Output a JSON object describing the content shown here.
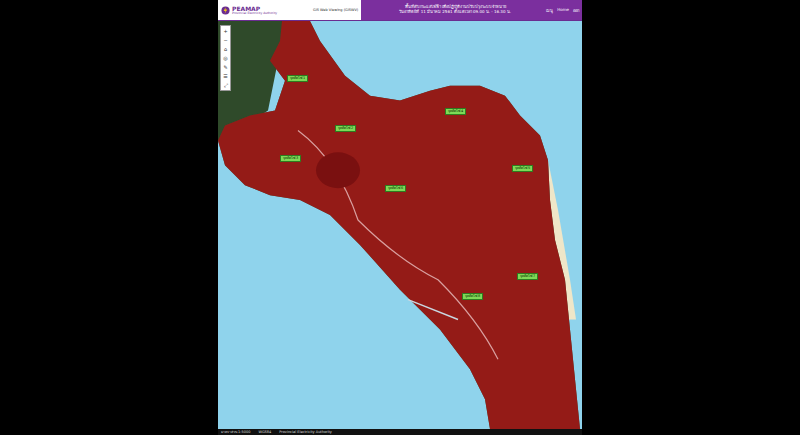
{
  "window": {
    "title": "PEAMAP"
  },
  "header": {
    "logo": "PEAMAP",
    "subtitle": "Provincial Electricity Authority",
    "app": "GIS Web Viewing (GISWV)",
    "title_lines": [
      "พื้นที่ดับกระแสไฟฟ้า เพื่อปฏิบัติงานปรับปรุงระบบจำหน่าย",
      "วันอาทิตย์ที่ 11 มีนาคม 2561 ตั้งแต่เวลา 09.00 น. - 16.30 น."
    ],
    "menu": [
      "เมนู",
      "Home",
      "ออก"
    ]
  },
  "toolbar": [
    "+",
    "−",
    "⌂",
    "◎",
    "✎",
    "☰",
    "⤢"
  ],
  "map": {
    "labels": [
      {
        "text": "จุดตัดไฟ 1"
      },
      {
        "text": "จุดตัดไฟ 2"
      },
      {
        "text": "จุดตัดไฟ 3"
      },
      {
        "text": "จุดตัดไฟ 4"
      },
      {
        "text": "จุดตัดไฟ 5"
      },
      {
        "text": "จุดตัดไฟ 6"
      },
      {
        "text": "จุดตัดไฟ 7"
      },
      {
        "text": "จุดตัดไฟ 8"
      }
    ]
  },
  "status_bar": {
    "items": [
      "มาตราส่วน 1:5000",
      "WGS84",
      "Provincial Electricity Authority"
    ]
  }
}
